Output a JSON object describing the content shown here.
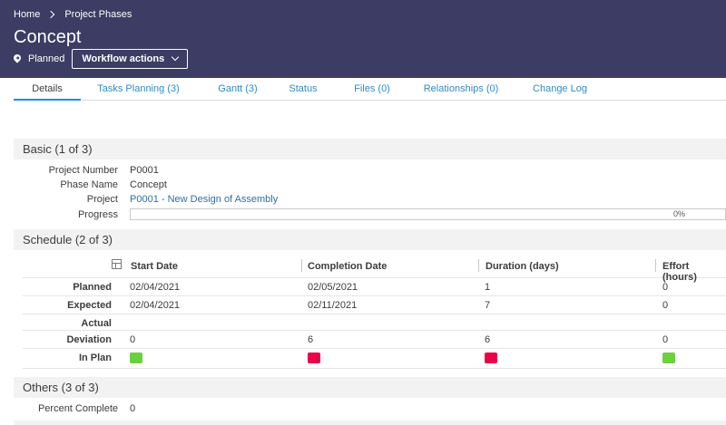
{
  "header": {
    "breadcrumbs": [
      "Home",
      "Project Phases"
    ],
    "title": "Concept",
    "status": "Planned",
    "workflow_button": "Workflow actions"
  },
  "tabs": [
    {
      "label": "Details",
      "active": true
    },
    {
      "label": "Tasks Planning (3)",
      "active": false
    },
    {
      "label": "Gantt (3)",
      "active": false
    },
    {
      "label": "Status",
      "active": false
    },
    {
      "label": "Files (0)",
      "active": false
    },
    {
      "label": "Relationships (0)",
      "active": false
    },
    {
      "label": "Change Log",
      "active": false
    }
  ],
  "basic": {
    "heading": "Basic (1 of 3)",
    "fields": [
      {
        "label": "Project Number",
        "value": "P0001"
      },
      {
        "label": "Phase Name",
        "value": "Concept"
      },
      {
        "label": "Project",
        "value": "P0001 - New Design of Assembly"
      },
      {
        "label": "Progress",
        "value": "0%"
      }
    ],
    "progress_fraction": 0
  },
  "schedule": {
    "heading": "Schedule (2 of 3)",
    "columns": [
      "Start Date",
      "Completion Date",
      "Duration (days)",
      "Effort (hours)"
    ],
    "rows": [
      {
        "label": "Planned",
        "cells": [
          "02/04/2021",
          "02/05/2021",
          "1",
          "0"
        ]
      },
      {
        "label": "Expected",
        "cells": [
          "02/04/2021",
          "02/11/2021",
          "7",
          "0"
        ]
      },
      {
        "label": "Actual",
        "cells": [
          "",
          "",
          "",
          ""
        ]
      },
      {
        "label": "Deviation",
        "cells": [
          "0",
          "6",
          "6",
          "0"
        ]
      }
    ],
    "in_plan": {
      "label": "In Plan",
      "status": [
        "green",
        "red",
        "red",
        "green"
      ]
    }
  },
  "others": {
    "heading": "Others (3 of 3)",
    "fields": [
      {
        "label": "Percent Complete",
        "value": "0"
      }
    ]
  },
  "colors": {
    "header_bg": "#3c3c64",
    "link": "#2d6fa8",
    "tab_link": "#2d8cc8",
    "accent": "#0696d7",
    "green": "#6ad13c",
    "red": "#ec0047"
  }
}
